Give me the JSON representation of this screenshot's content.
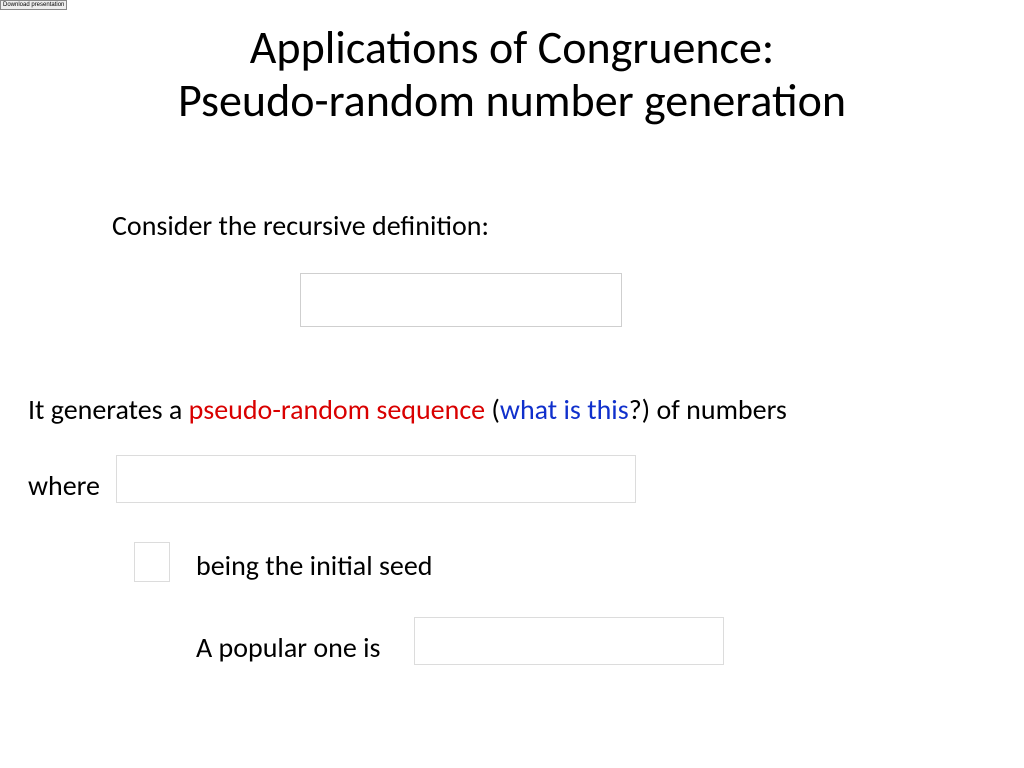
{
  "topBadge": "Download presentation",
  "title": {
    "line1": "Applications of Congruence:",
    "line2": "Pseudo-random number generation"
  },
  "consider": "Consider the recursive definition:",
  "genline": {
    "prefix": "It generates a ",
    "term": "pseudo-random sequence",
    "openParen": " (",
    "question": "what is this",
    "qmark": "?",
    "closeParen": ")",
    "suffix": " of numbers"
  },
  "whereLabel": "where",
  "seedText": "being the initial seed",
  "popularText": "A popular one is"
}
